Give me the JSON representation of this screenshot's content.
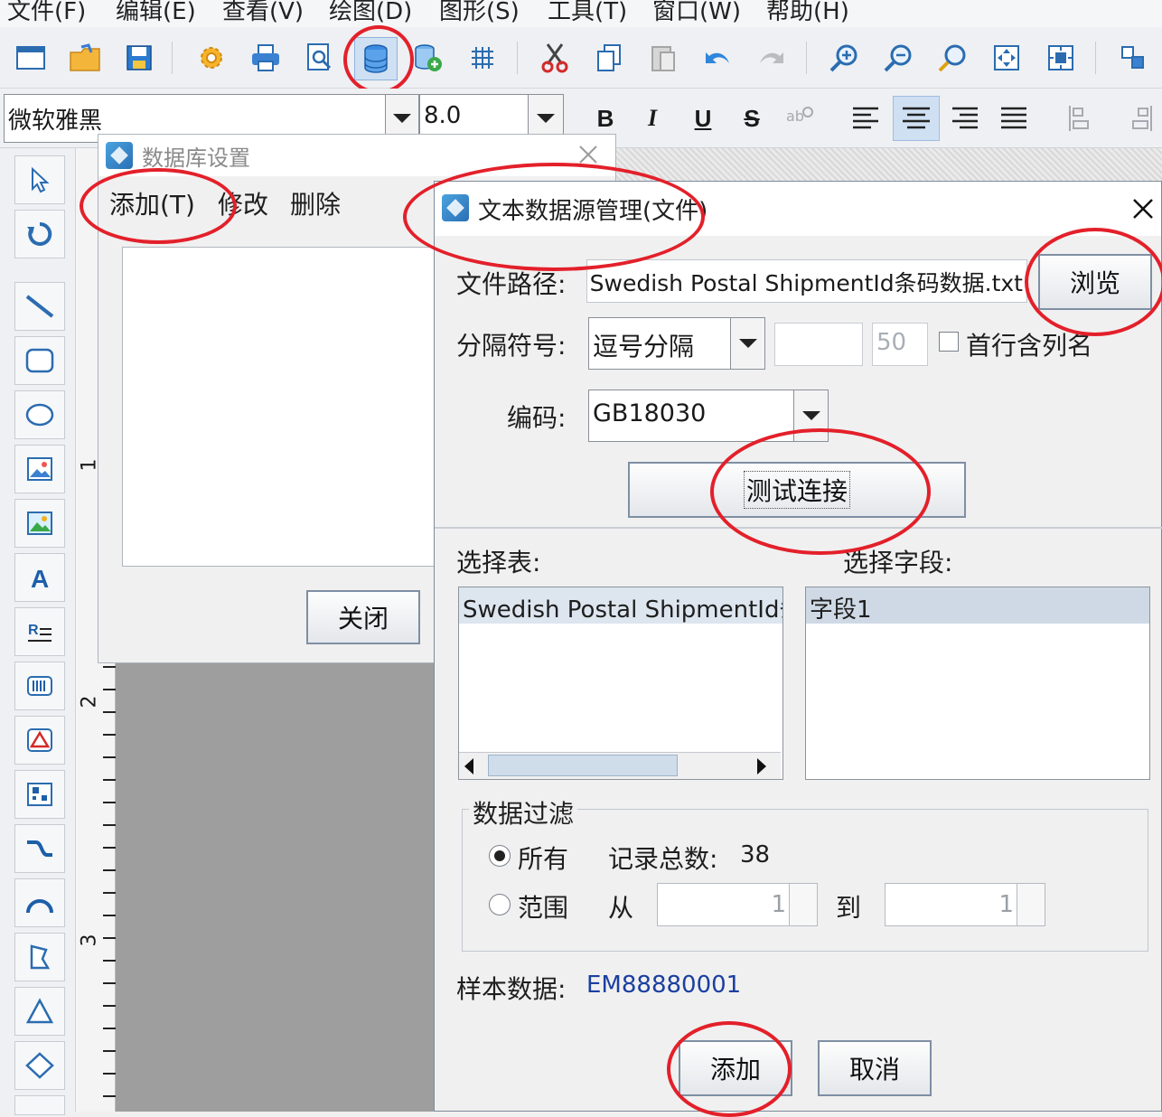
{
  "menubar": {
    "items": [
      "文件(F)",
      "编辑(E)",
      "查看(V)",
      "绘图(D)",
      "图形(S)",
      "工具(T)",
      "窗口(W)",
      "帮助(H)"
    ]
  },
  "toolbar1": {
    "icons": [
      "new-window-icon",
      "open-folder-icon",
      "save-icon",
      "settings-gear-icon",
      "print-icon",
      "print-preview-icon",
      "database-icon",
      "database-add-icon",
      "grid-icon",
      "cut-icon",
      "copy-icon",
      "paste-icon",
      "undo-icon",
      "redo-icon",
      "zoom-in-icon",
      "zoom-out-icon",
      "zoom-icon",
      "fit-page-icon",
      "actual-size-icon",
      "layout-icon"
    ]
  },
  "toolbar2": {
    "font_name": "微软雅黑",
    "font_size": "8.0",
    "bold": "B",
    "italic": "I",
    "underline": "U",
    "strike": "S"
  },
  "ruler": {
    "mark_1": "1",
    "mark_2": "2",
    "mark_3": "3"
  },
  "db_dialog": {
    "title": "数据库设置",
    "add_label": "添加(T)",
    "modify_label": "修改",
    "delete_label": "删除",
    "close_label": "关闭"
  },
  "text_source_dialog": {
    "title": "文本数据源管理(文件)",
    "file_path_label": "文件路径:",
    "file_path_value": "Swedish Postal ShipmentId条码数据.txt",
    "browse_label": "浏览",
    "separator_label": "分隔符号:",
    "separator_value": "逗号分隔",
    "separator_count": "50",
    "first_row_header_label": "首行含列名",
    "encoding_label": "编码:",
    "encoding_value": "GB18030",
    "test_connection_label": "测试连接",
    "select_table_label": "选择表:",
    "table_item": "Swedish Postal ShipmentId条",
    "select_field_label": "选择字段:",
    "field_item": "字段1",
    "filter_group_label": "数据过滤",
    "all_label": "所有",
    "record_total_label": "记录总数:",
    "record_total_value": "38",
    "range_label": "范围",
    "from_label": "从",
    "from_value": "1",
    "to_label": "到",
    "to_value": "1",
    "sample_label": "样本数据:",
    "sample_value": "EM88880001",
    "add_label": "添加",
    "cancel_label": "取消"
  },
  "colors": {
    "annotation_red": "#e3202a",
    "sample_blue": "#1a3fa0",
    "selected_row": "#cfd9e6"
  }
}
